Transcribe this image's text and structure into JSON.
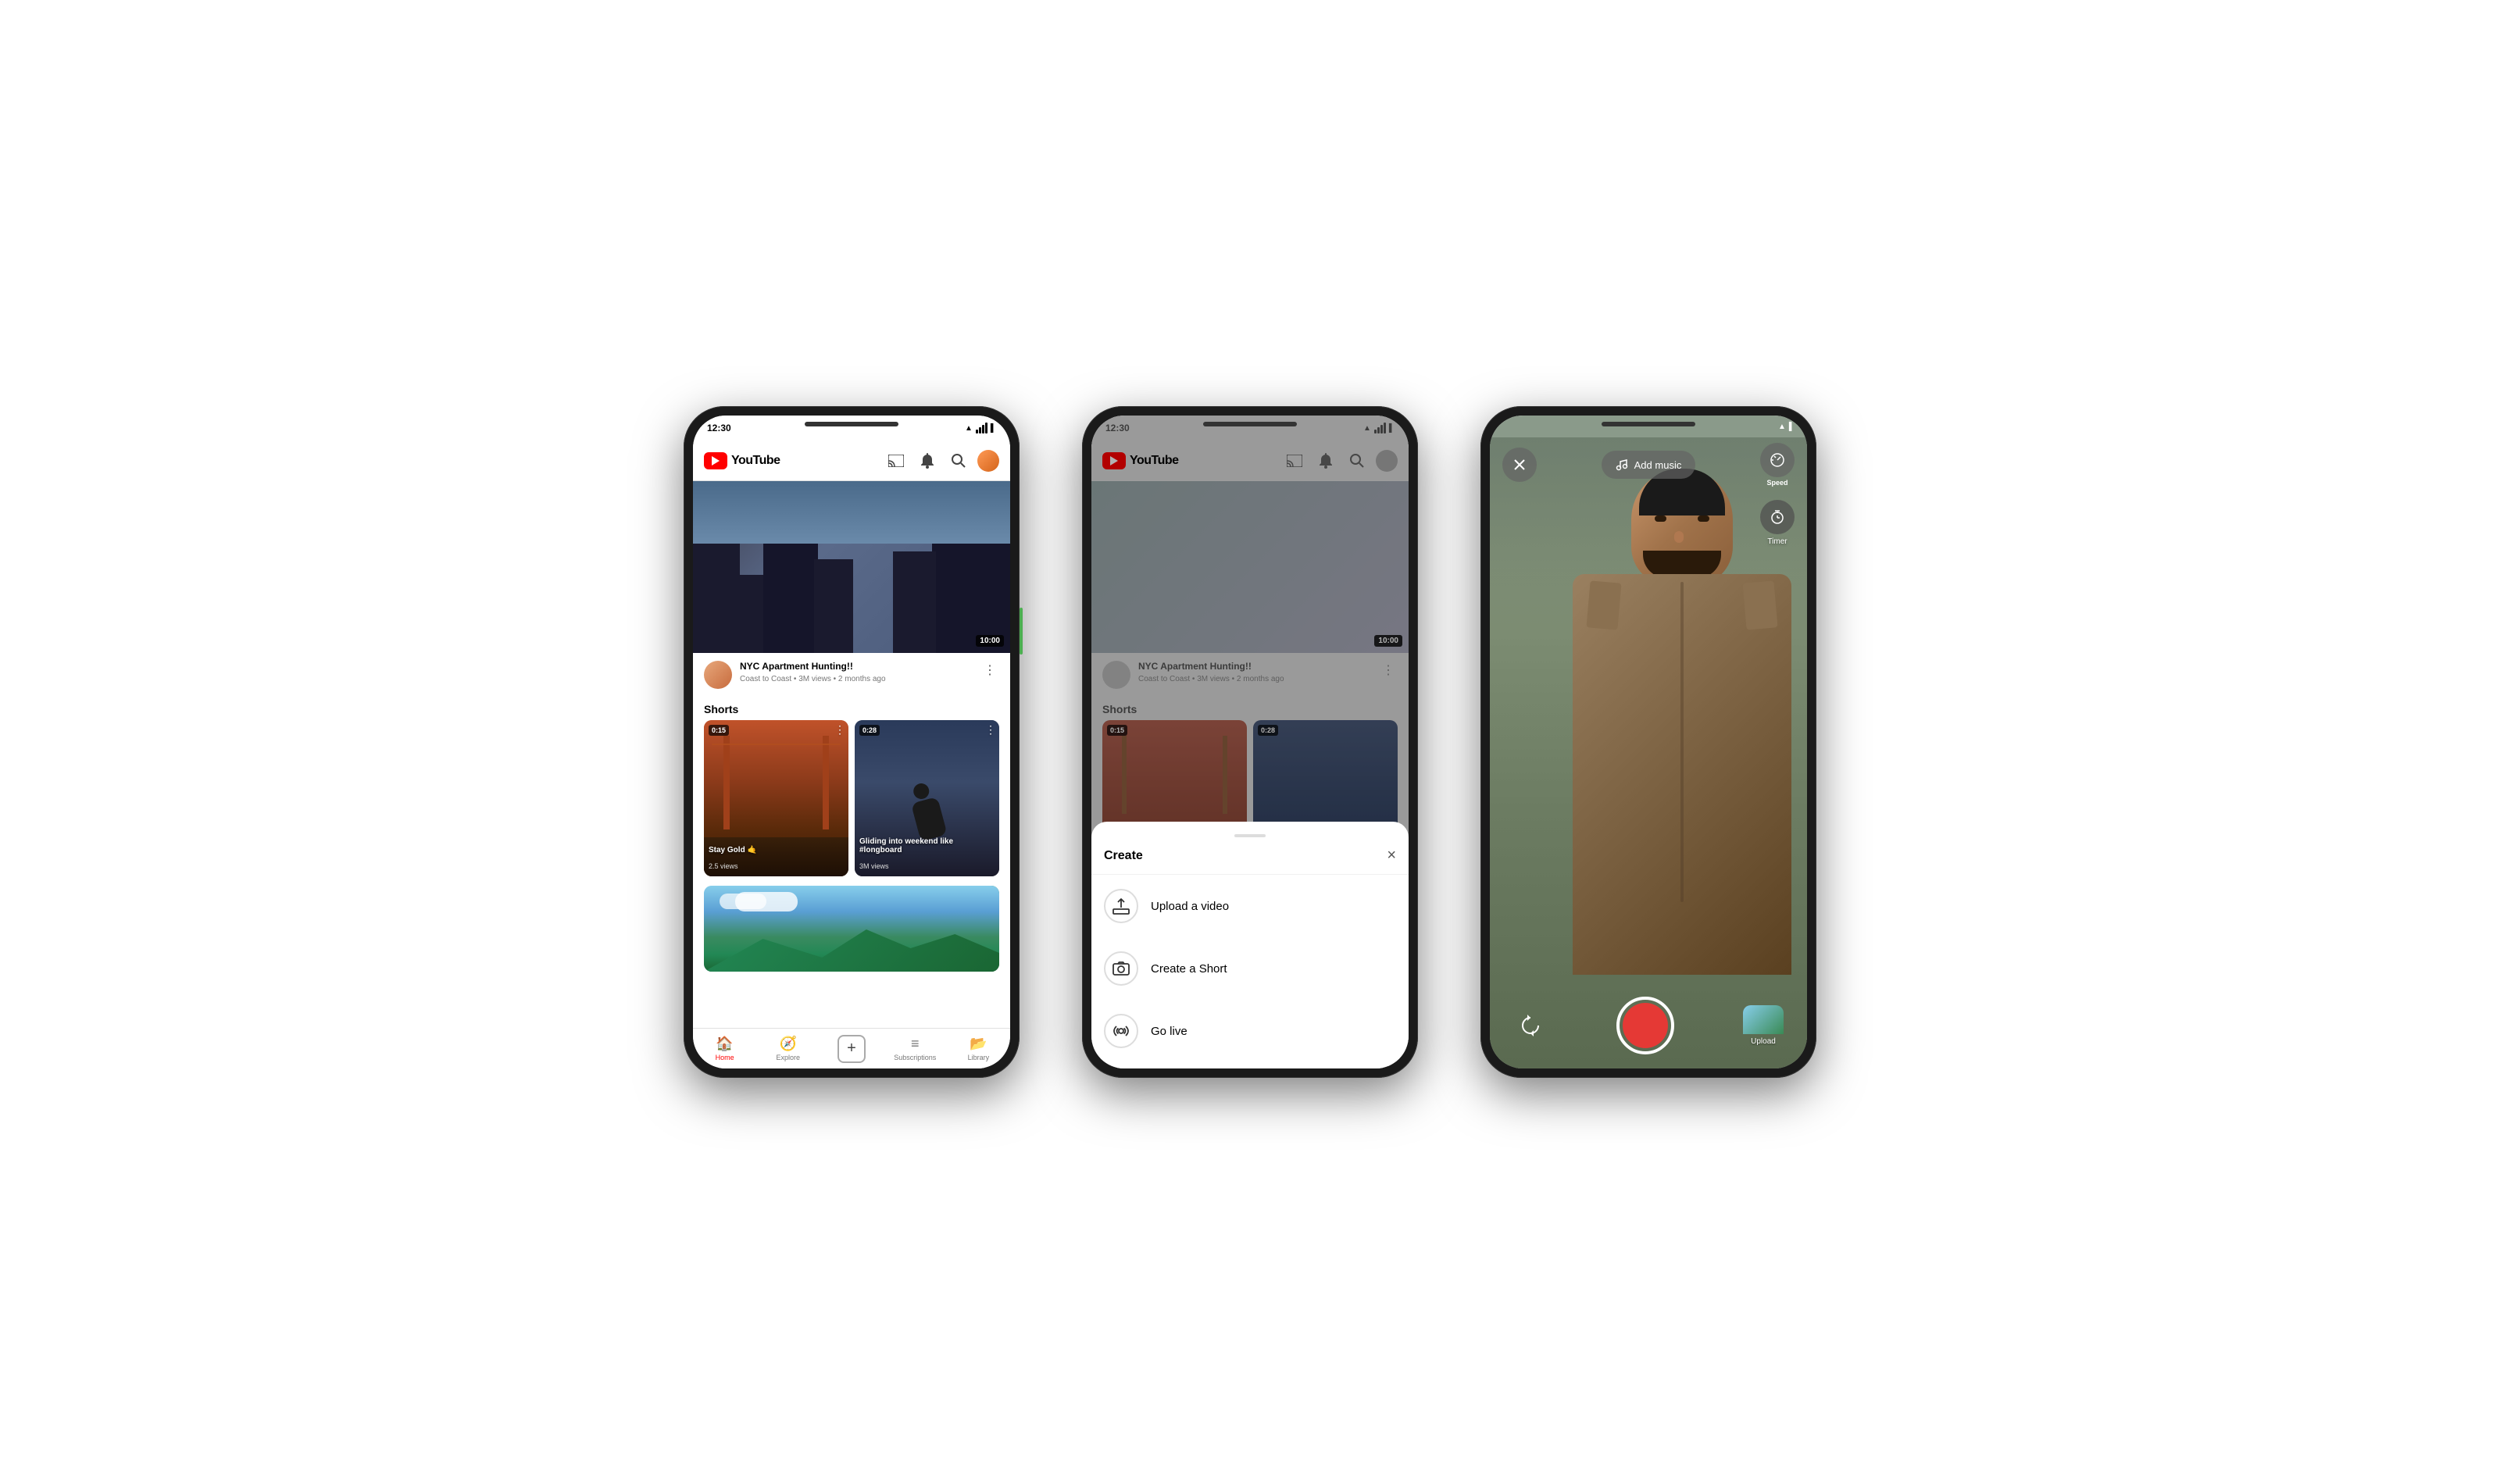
{
  "phones": {
    "phone1": {
      "status_bar": {
        "time": "12:30"
      },
      "header": {
        "logo_text": "YouTube",
        "cast_label": "cast",
        "bell_label": "notifications",
        "search_label": "search",
        "avatar_label": "profile"
      },
      "video": {
        "duration": "10:00",
        "title": "NYC Apartment Hunting!!",
        "subtitle": "Coast to Coast • 3M views • 2 months ago"
      },
      "shorts": {
        "section_title": "Shorts",
        "items": [
          {
            "time": "0:15",
            "label": "Stay Gold 🤙",
            "views": "2.5 views"
          },
          {
            "time": "0:28",
            "label": "Gliding into weekend like #longboard",
            "views": "3M views"
          }
        ]
      },
      "bottom_nav": {
        "items": [
          {
            "label": "Home",
            "active": true
          },
          {
            "label": "Explore",
            "active": false
          },
          {
            "label": "",
            "active": false,
            "is_create": true
          },
          {
            "label": "Subscriptions",
            "active": false
          },
          {
            "label": "Library",
            "active": false
          }
        ]
      }
    },
    "phone2": {
      "status_bar": {
        "time": "12:30"
      },
      "header": {
        "logo_text": "YouTube"
      },
      "video": {
        "duration": "10:00",
        "title": "NYC Apartment Hunting!!",
        "subtitle": "Coast to Coast • 3M views • 2 months ago"
      },
      "shorts": {
        "section_title": "Shorts",
        "items": [
          {
            "time": "0:15"
          },
          {
            "time": "0:28"
          }
        ]
      },
      "bottom_sheet": {
        "title": "Create",
        "close_label": "×",
        "items": [
          {
            "icon": "upload",
            "label": "Upload a video"
          },
          {
            "icon": "camera",
            "label": "Create a Short"
          },
          {
            "icon": "live",
            "label": "Go live"
          }
        ]
      }
    },
    "phone3": {
      "status_bar": {
        "time": ""
      },
      "camera": {
        "add_music_label": "Add music",
        "speed_label": "Speed",
        "timer_label": "Timer",
        "upload_label": "Upload",
        "close_label": "×"
      }
    }
  }
}
